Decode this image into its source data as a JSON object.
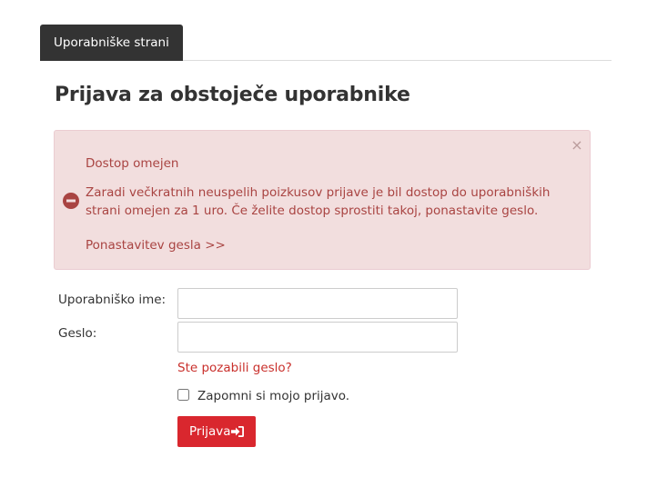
{
  "tabs": {
    "active_label": "Uporabniške strani"
  },
  "page": {
    "title": "Prijava za obstoječe uporabnike"
  },
  "alert": {
    "close_symbol": "×",
    "title": "Dostop omejen",
    "message": "Zaradi večkratnih neuspelih poizkusov prijave je bil dostop do uporabniških strani omejen za 1 uro. Če želite dostop sprostiti takoj, ponastavite geslo.",
    "link_label": "Ponastavitev gesla  >>",
    "icon": "minus-circle-icon"
  },
  "form": {
    "username_label": "Uporabniško ime:",
    "username_value": "",
    "password_label": "Geslo:",
    "password_value": "",
    "forgot_label": "Ste pozabili geslo?",
    "remember_label": "Zapomni si mojo prijavo.",
    "remember_checked": false,
    "submit_label": "Prijava",
    "submit_icon": "sign-in-icon"
  },
  "colors": {
    "tab_bg": "#333333",
    "alert_bg": "#f2dede",
    "alert_text": "#a94442",
    "button_bg": "#d9272e",
    "link": "#c9302c"
  }
}
